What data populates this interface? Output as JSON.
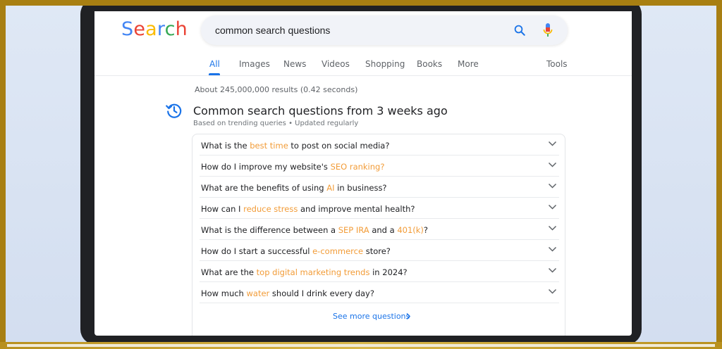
{
  "search": {
    "logo": [
      "S",
      "e",
      "a",
      "r",
      "c",
      "h"
    ],
    "logo_colors": [
      "#4285f4",
      "#ea4335",
      "#fbbc05",
      "#4285f4",
      "#34a853",
      "#ea4335"
    ],
    "query": "common search questions"
  },
  "tabs": [
    {
      "label": "All",
      "active": true
    },
    {
      "label": "Images"
    },
    {
      "label": "News"
    },
    {
      "label": "Videos"
    },
    {
      "label": "Shopping"
    },
    {
      "label": "Books"
    },
    {
      "label": "More"
    },
    {
      "label": "Tools"
    }
  ],
  "results_count": "About 245,000,000 results (0.42 seconds)",
  "section": {
    "title": "Common search questions from 3 weeks ago",
    "subtitle": "Based on trending queries • Updated regularly"
  },
  "questions": [
    {
      "pre": "What is the ",
      "hl": "best time",
      "post": " to post on social media?"
    },
    {
      "pre": "How do I improve my website's ",
      "hl": "SEO ranking?",
      "post": ""
    },
    {
      "pre": "What are the benefits of using ",
      "hl": "AI",
      "post": " in business?"
    },
    {
      "pre": "How can I ",
      "hl": "reduce stress",
      "post": " and improve mental health?"
    },
    {
      "pre": "What is the difference between a ",
      "hl": "SEP IRA",
      "mid": " and a ",
      "hl2": "401(k)",
      "post": "?"
    },
    {
      "pre": "How do I start a successful ",
      "hl": "e-commerce",
      "post": " store?"
    },
    {
      "pre": "What are the ",
      "hl": "top digital marketing trends",
      "post": " in 2024?"
    },
    {
      "pre": "How much ",
      "hl": "water",
      "post": " should I drink every day?"
    }
  ],
  "see_more": "See more questions",
  "colors": {
    "accent": "#1a73e8",
    "highlight": "#f29c38",
    "frame": "#a87f12"
  }
}
